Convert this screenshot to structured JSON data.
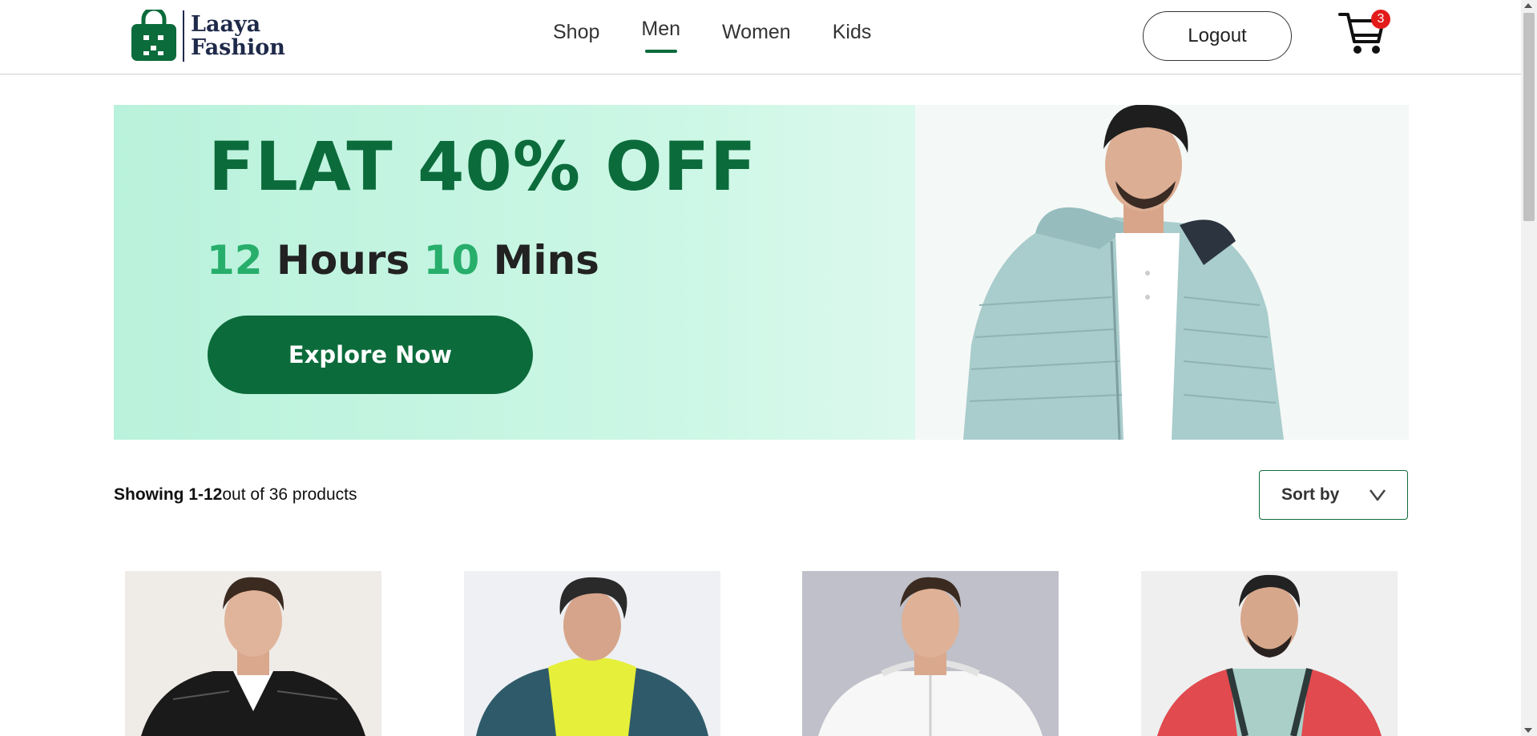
{
  "brand": {
    "line1": "Laaya",
    "line2": "Fashion"
  },
  "nav": {
    "items": [
      {
        "label": "Shop"
      },
      {
        "label": "Men"
      },
      {
        "label": "Women"
      },
      {
        "label": "Kids"
      }
    ],
    "active_index": 1
  },
  "header": {
    "logout_label": "Logout",
    "cart_count": "3",
    "cart_icon": "shopping-cart-icon"
  },
  "banner": {
    "title": "FLAT 40% OFF",
    "timer": {
      "hours": "12",
      "hours_label": "Hours",
      "mins": "10",
      "mins_label": "Mins"
    },
    "cta_label": "Explore Now"
  },
  "toolbar": {
    "showing_range": "Showing 1-12",
    "showing_total": "out of 36 products",
    "sort_label": "Sort by",
    "sort_icon": "chevron-down-icon"
  },
  "colors": {
    "brand_green": "#0c6b3b",
    "accent_green": "#27ae6b",
    "banner_bg": "#b9f2dc",
    "badge_red": "#e31b1b",
    "logo_navy": "#1f2a4a"
  }
}
